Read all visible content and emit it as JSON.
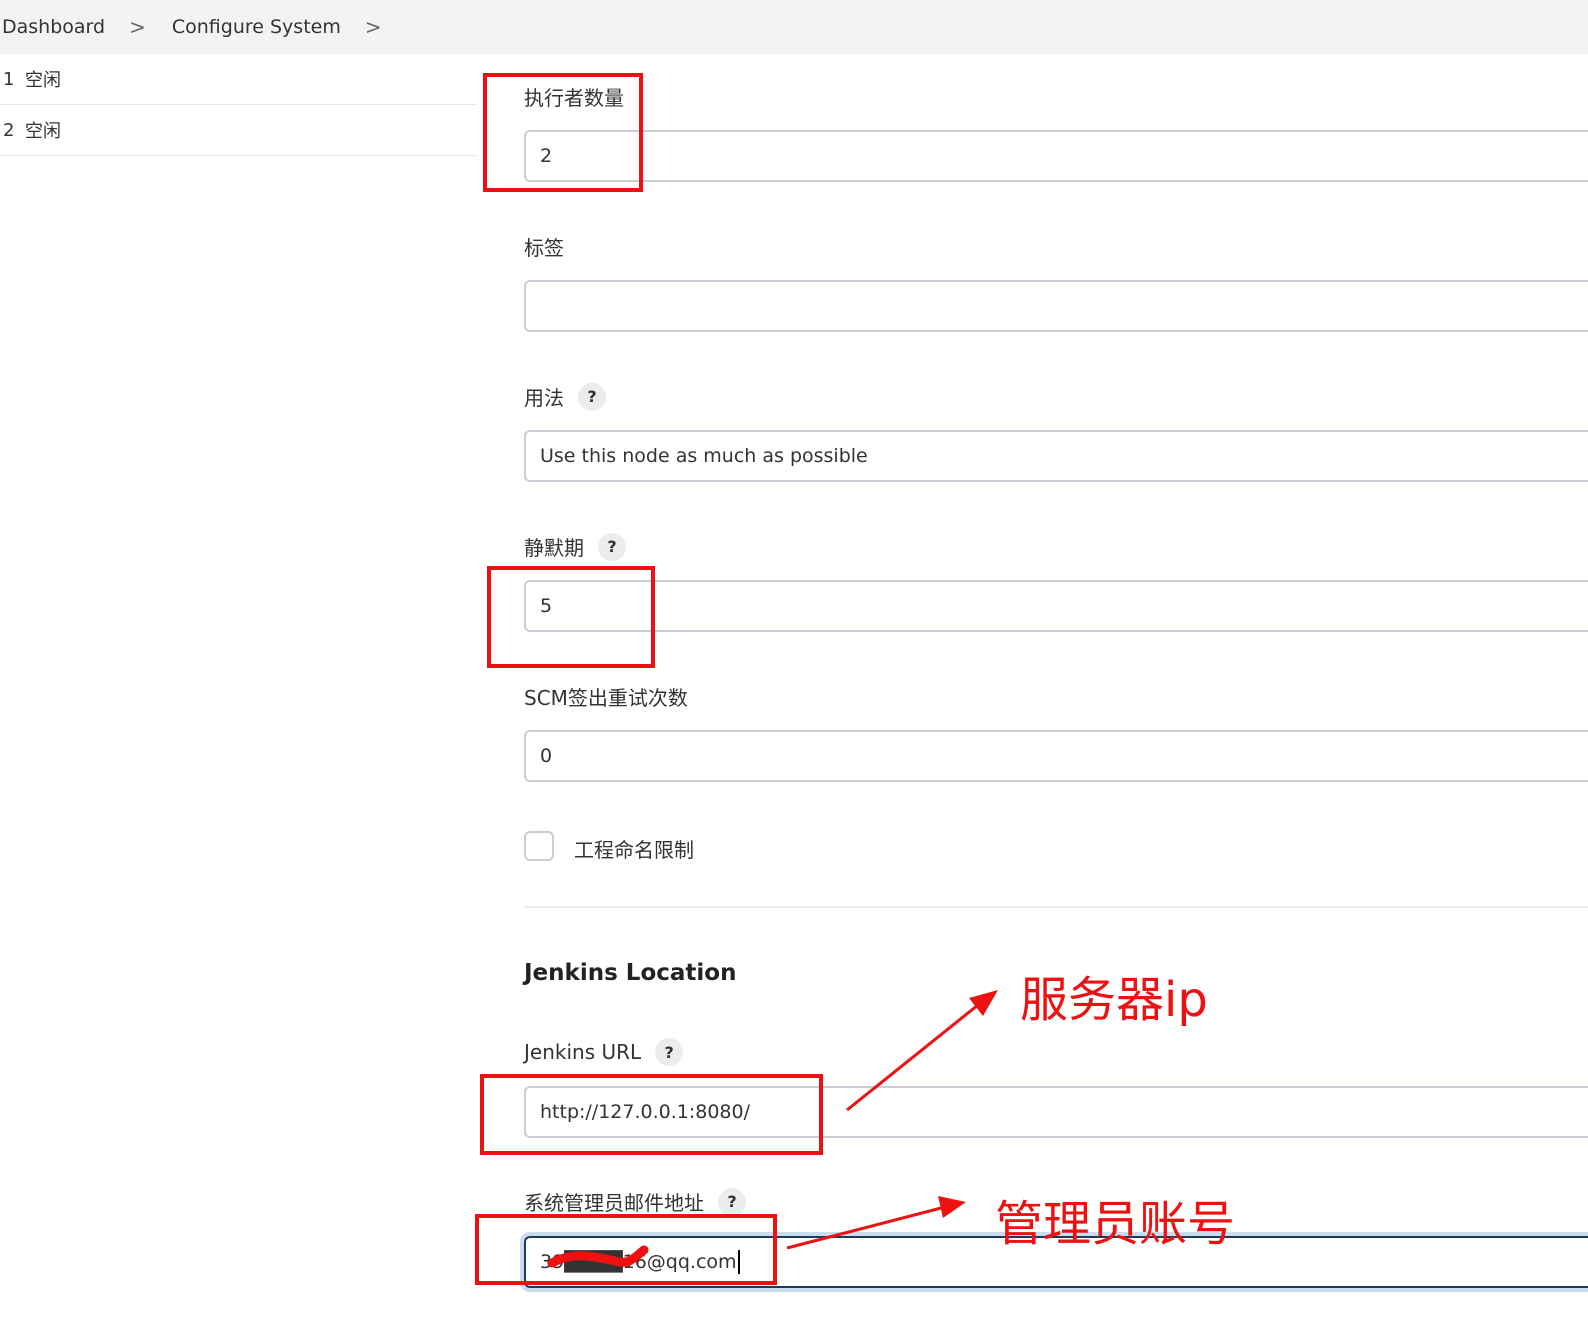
{
  "breadcrumb": {
    "items": [
      "Dashboard",
      "Configure System"
    ],
    "separator": ">"
  },
  "executors": [
    {
      "number": "1",
      "status": "空闲"
    },
    {
      "number": "2",
      "status": "空闲"
    }
  ],
  "form": {
    "executors_label": "执行者数量",
    "executors_value": "2",
    "labels_label": "标签",
    "labels_value": "",
    "usage_label": "用法",
    "usage_value": "Use this node as much as possible",
    "quiet_period_label": "静默期",
    "quiet_period_value": "5",
    "scm_retry_label": "SCM签出重试次数",
    "scm_retry_value": "0",
    "project_naming_label": "工程命名限制",
    "project_naming_checked": false,
    "help_glyph": "?"
  },
  "jenkins_location": {
    "title": "Jenkins Location",
    "url_label": "Jenkins URL",
    "url_value": "http://127.0.0.1:8080/",
    "admin_email_label": "系统管理员邮件地址",
    "admin_email_value": "39████16@qq.com"
  },
  "annotations": {
    "server_ip": "服务器ip",
    "admin_account": "管理员账号",
    "color": "#ee1111"
  },
  "colors": {
    "input_border": "#c9ced6",
    "focus_border": "#1f3b57",
    "header_bg": "#f3f3f3"
  }
}
